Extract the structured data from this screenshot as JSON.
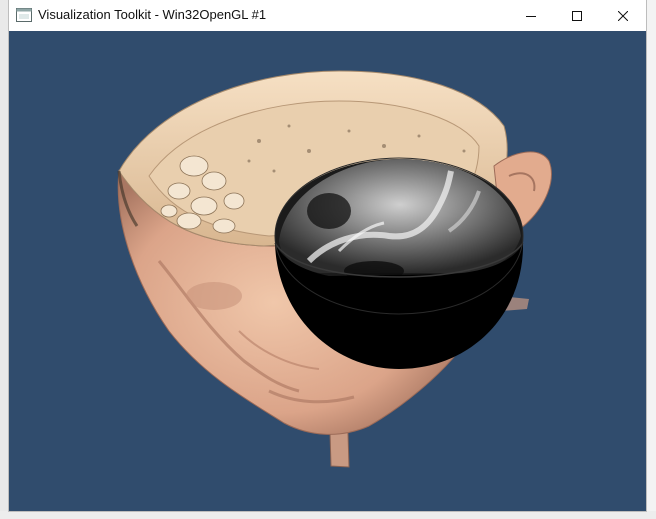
{
  "window": {
    "title": "Visualization Toolkit - Win32OpenGL #1",
    "controls": [
      "minimize-icon",
      "maximize-icon",
      "close-icon"
    ]
  },
  "viewport": {
    "background_color": "#304c6d",
    "scene": "head-surface-with-hemispherical-clip"
  },
  "colors": {
    "skin": "#e8b898",
    "skin_shadow": "#b7816a",
    "titlebar": "#ffffff"
  }
}
